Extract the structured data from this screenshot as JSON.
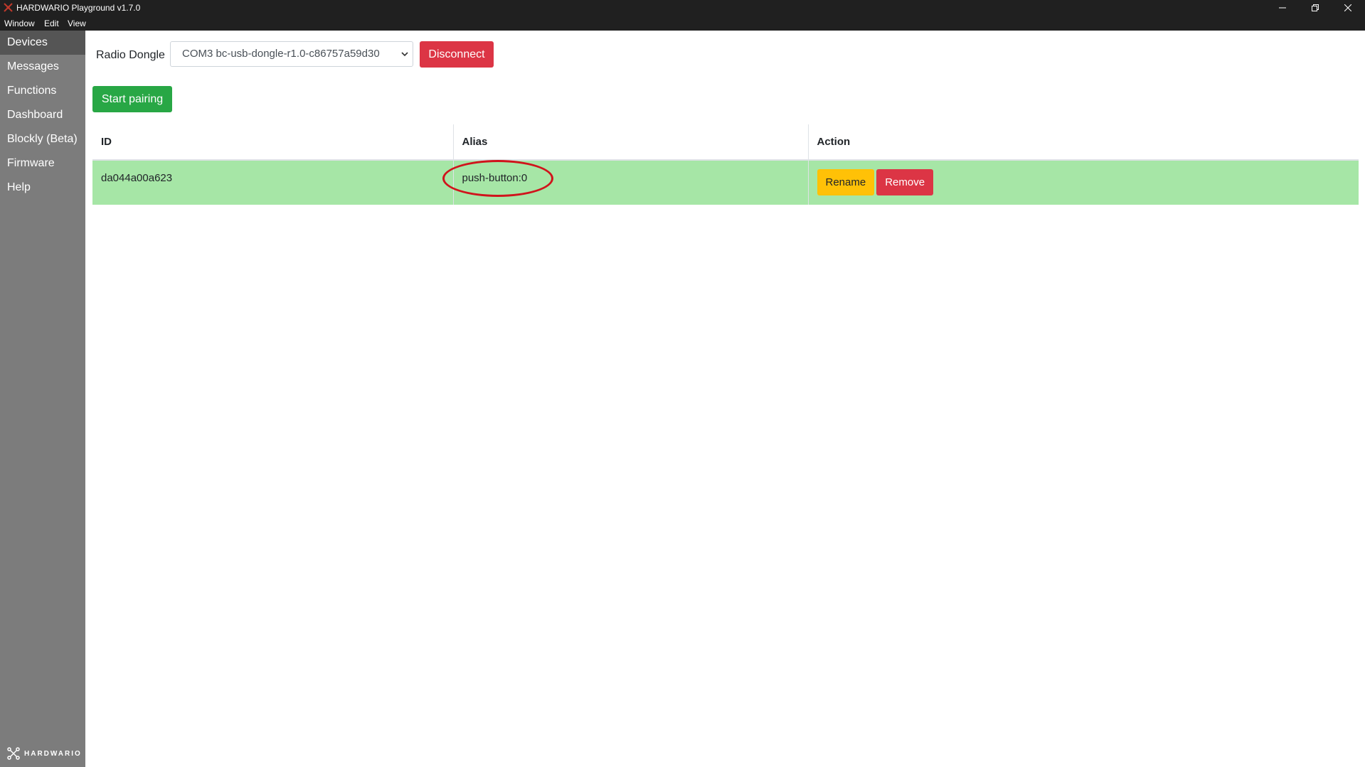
{
  "window": {
    "title": "HARDWARIO Playground v1.7.0",
    "controls": [
      "minimize",
      "restore",
      "close"
    ]
  },
  "menu": [
    "Window",
    "Edit",
    "View"
  ],
  "sidebar": {
    "items": [
      {
        "label": "Devices",
        "active": true
      },
      {
        "label": "Messages"
      },
      {
        "label": "Functions"
      },
      {
        "label": "Dashboard"
      },
      {
        "label": "Blockly (Beta)"
      },
      {
        "label": "Firmware"
      },
      {
        "label": "Help"
      }
    ],
    "brand": "HARDWARIO"
  },
  "dongle": {
    "label": "Radio Dongle",
    "selected": "COM3 bc-usb-dongle-r1.0-c86757a59d30",
    "disconnect_label": "Disconnect"
  },
  "pairing_label": "Start pairing",
  "table": {
    "headers": [
      "ID",
      "Alias",
      "Action"
    ],
    "rows": [
      {
        "id": "da044a00a623",
        "alias": "push-button:0",
        "rename": "Rename",
        "remove": "Remove"
      }
    ]
  },
  "colors": {
    "titlebar": "#202020",
    "sidebar": "#7c7c7c",
    "sidebar_active": "#555555",
    "danger": "#dc3545",
    "success": "#28a745",
    "warning": "#ffc107",
    "row_highlight": "#a6e6a6",
    "annotation_ring": "#d0141c"
  }
}
